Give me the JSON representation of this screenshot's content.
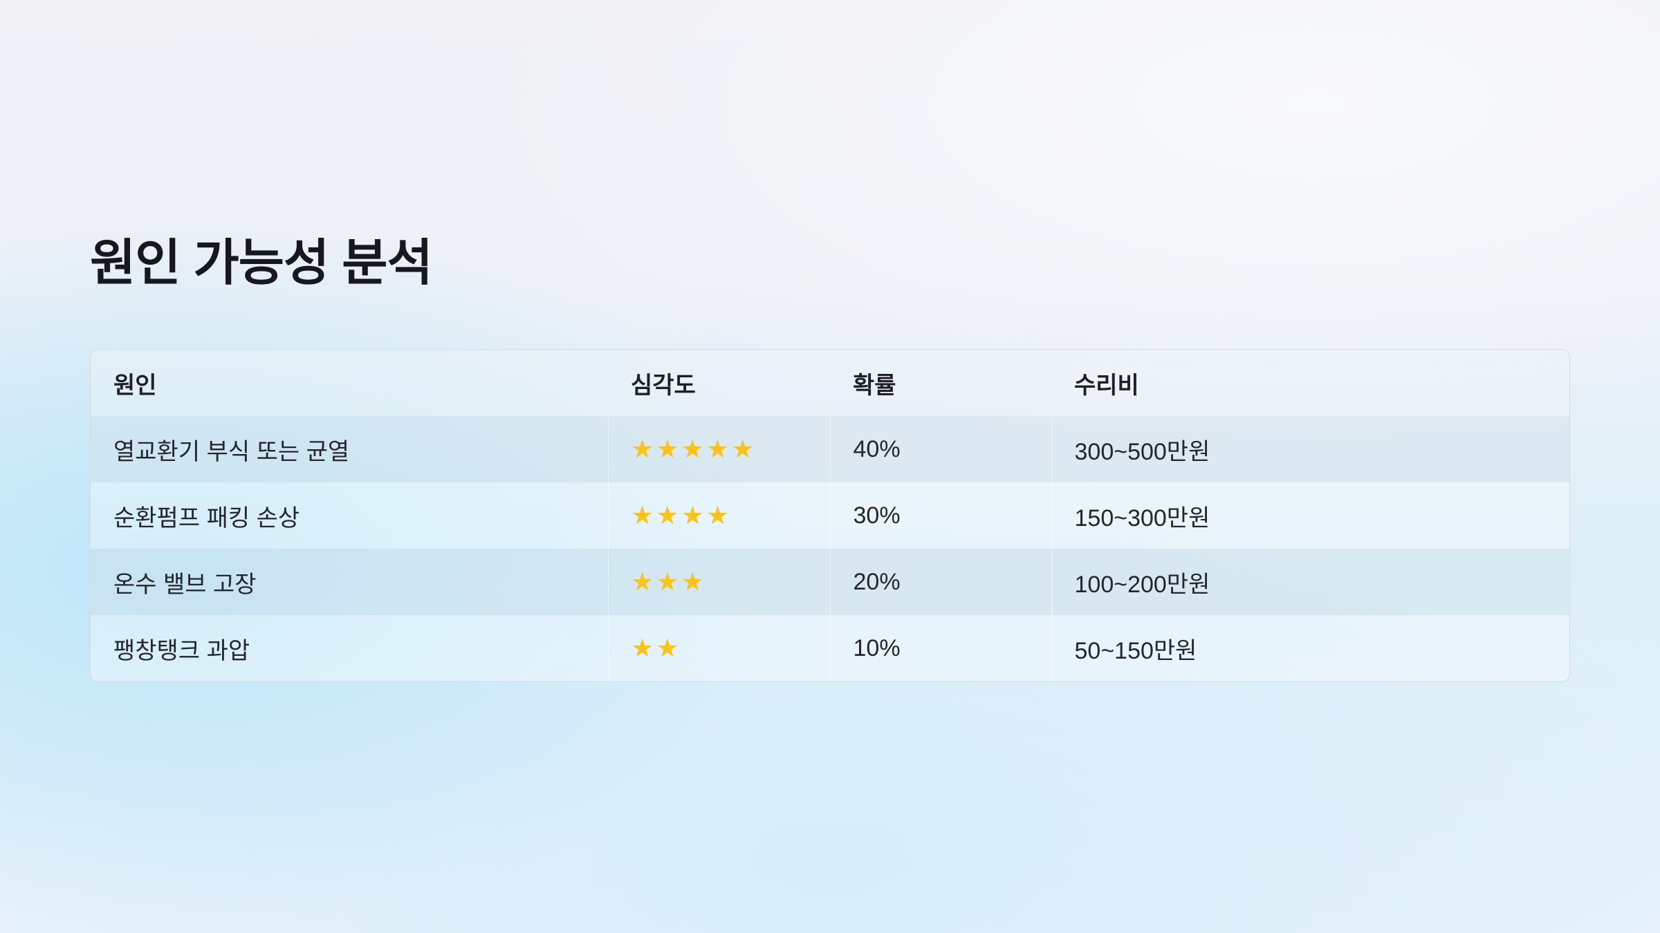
{
  "title": "원인 가능성 분석",
  "table": {
    "headers": [
      "원인",
      "심각도",
      "확률",
      "수리비"
    ],
    "rows": [
      {
        "cause": "열교환기 부식 또는 균열",
        "severity": 5,
        "probability": "40%",
        "cost": "300~500만원"
      },
      {
        "cause": "순환펌프 패킹 손상",
        "severity": 4,
        "probability": "30%",
        "cost": "150~300만원"
      },
      {
        "cause": "온수 밸브 고장",
        "severity": 3,
        "probability": "20%",
        "cost": "100~200만원"
      },
      {
        "cause": "팽창탱크 과압",
        "severity": 2,
        "probability": "10%",
        "cost": "50~150만원"
      }
    ],
    "star_icon": "star-icon",
    "star_color": "#f8c31c"
  }
}
